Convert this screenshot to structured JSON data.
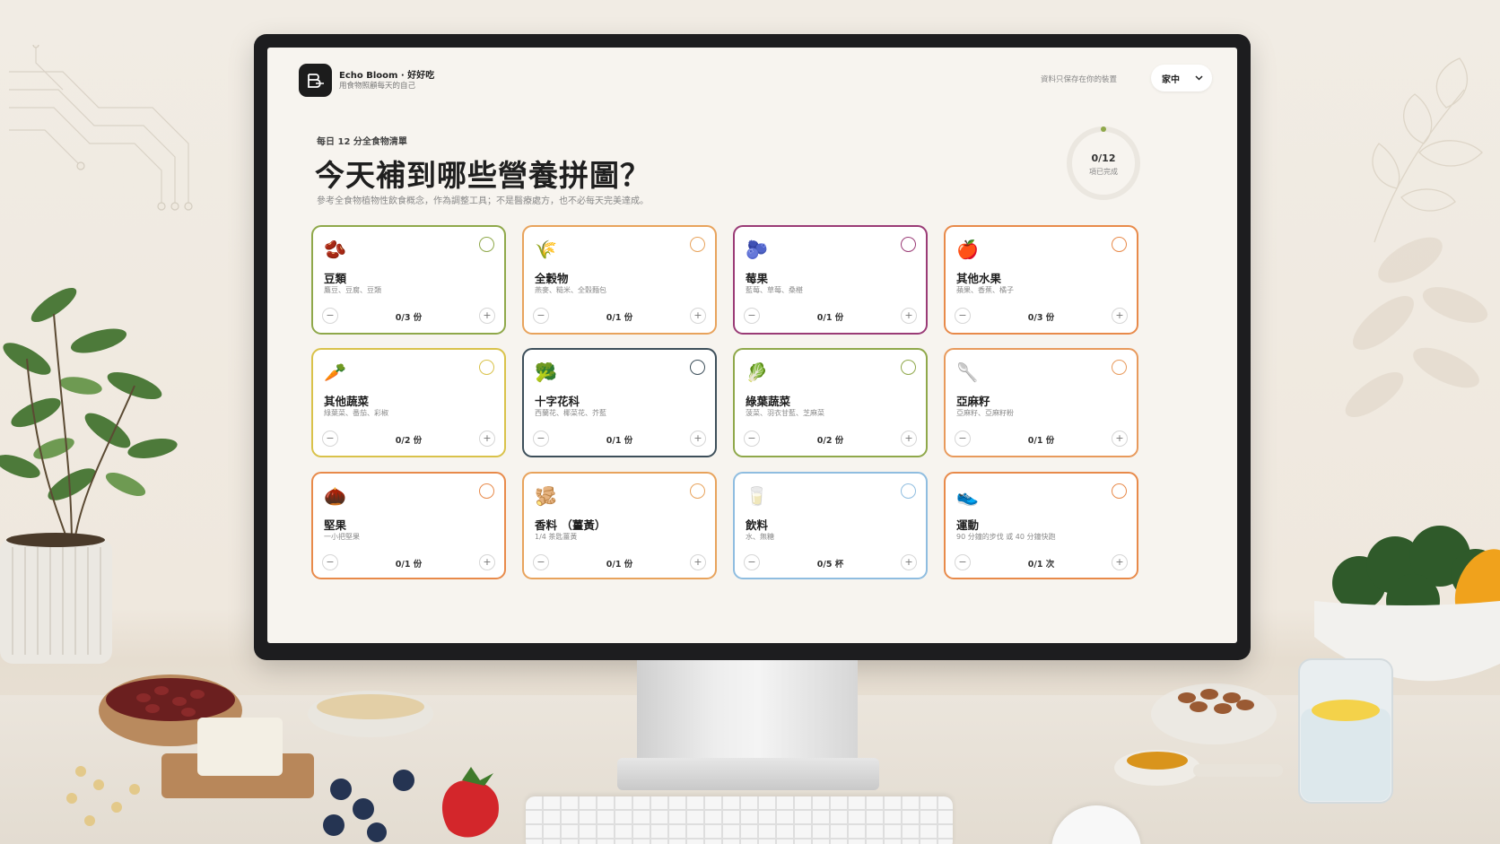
{
  "app": {
    "name": "Echo Bloom · 好好吃",
    "tagline": "用食物照顧每天的自己",
    "privacy_note": "資料只保存在你的裝置",
    "profile_select": "家中"
  },
  "hero": {
    "eyebrow": "每日 12 分全食物清單",
    "title": "今天補到哪些營養拼圖？",
    "subtitle": "參考全食物植物性飲食概念，作為調整工具；不是醫療處方，也不必每天完美達成。"
  },
  "progress": {
    "count": "0/12",
    "label": "項已完成",
    "fraction": 0
  },
  "cards": [
    {
      "name": "豆類",
      "desc": "鷹豆、豆腐、豆類",
      "count": "0/3 份",
      "icon": "🫘",
      "color": "#8fa84a"
    },
    {
      "name": "全穀物",
      "desc": "燕麥、糙米、全穀麵包",
      "count": "0/1 份",
      "icon": "🌾",
      "color": "#e8a35c"
    },
    {
      "name": "莓果",
      "desc": "藍莓、草莓、桑椹",
      "count": "0/1 份",
      "icon": "🫐",
      "color": "#9a3b76"
    },
    {
      "name": "其他水果",
      "desc": "蘋果、香蕉、橘子",
      "count": "0/3 份",
      "icon": "🍎",
      "color": "#e88a4a"
    },
    {
      "name": "其他蔬菜",
      "desc": "綠葉菜、番茄、彩椒",
      "count": "0/2 份",
      "icon": "🥕",
      "color": "#d9c24a"
    },
    {
      "name": "十字花科",
      "desc": "西蘭花、椰菜花、芥藍",
      "count": "0/1 份",
      "icon": "🥦",
      "color": "#3d4f5a"
    },
    {
      "name": "綠葉蔬菜",
      "desc": "菠菜、羽衣甘藍、芝麻菜",
      "count": "0/2 份",
      "icon": "🥬",
      "color": "#8fa84a"
    },
    {
      "name": "亞麻籽",
      "desc": "亞麻籽、亞麻籽粉",
      "count": "0/1 份",
      "icon": "🥄",
      "color": "#e89a5c"
    },
    {
      "name": "堅果",
      "desc": "一小把堅果",
      "count": "0/1 份",
      "icon": "🌰",
      "color": "#e88a4a"
    },
    {
      "name": "香料 （薑黃）",
      "desc": "1/4 茶匙薑黃",
      "count": "0/1 份",
      "icon": "🫚",
      "color": "#e8a35c"
    },
    {
      "name": "飲料",
      "desc": "水、無糖",
      "count": "0/5 杯",
      "icon": "🥛",
      "color": "#8fbde0"
    },
    {
      "name": "運動",
      "desc": "90 分鐘的步伐 或 40 分鐘快跑",
      "count": "0/1 次",
      "icon": "👟",
      "color": "#e88a4a"
    }
  ],
  "controls": {
    "minus": "−",
    "plus": "+"
  }
}
